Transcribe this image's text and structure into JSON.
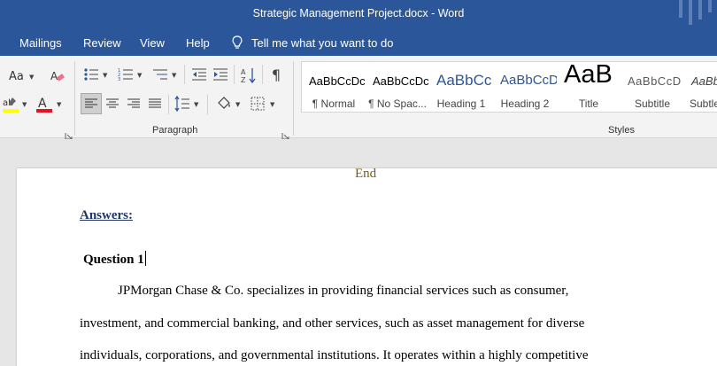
{
  "window": {
    "title": "Strategic Management Project.docx  -  Word"
  },
  "tabs": [
    {
      "label": "Mailings"
    },
    {
      "label": "Review"
    },
    {
      "label": "View"
    },
    {
      "label": "Help"
    }
  ],
  "tell_me": {
    "placeholder": "Tell me what you want to do"
  },
  "ribbon": {
    "font_size_glyph": "Aa",
    "paragraph_group_label": "Paragraph",
    "styles_group_label": "Styles",
    "styles": [
      {
        "sample": "AaBbCcDc",
        "name": "¶ Normal"
      },
      {
        "sample": "AaBbCcDc",
        "name": "¶ No Spac..."
      },
      {
        "sample": "AaBbCc",
        "name": "Heading 1"
      },
      {
        "sample": "AaBbCcD",
        "name": "Heading 2"
      },
      {
        "sample": "AaB",
        "name": "Title"
      },
      {
        "sample": "AaBbCcD",
        "name": "Subtitle"
      },
      {
        "sample": "AaBb",
        "name": "Subtle"
      }
    ]
  },
  "document": {
    "end_text": "End",
    "answers_heading": "Answers:",
    "question_heading": "Question 1",
    "paragraph_lines": [
      "JPMorgan Chase & Co. specializes in providing financial services such as consumer,",
      "investment, and commercial banking, and other services, such as asset management for diverse",
      "individuals, corporations, and governmental institutions. It operates within a highly competitive"
    ]
  },
  "colors": {
    "title_bar": "#2b579a",
    "ribbon_bg": "#f3f3f3",
    "heading_blue": "#2f5496",
    "answers_color": "#1f3864",
    "end_color": "#7a5c00"
  }
}
